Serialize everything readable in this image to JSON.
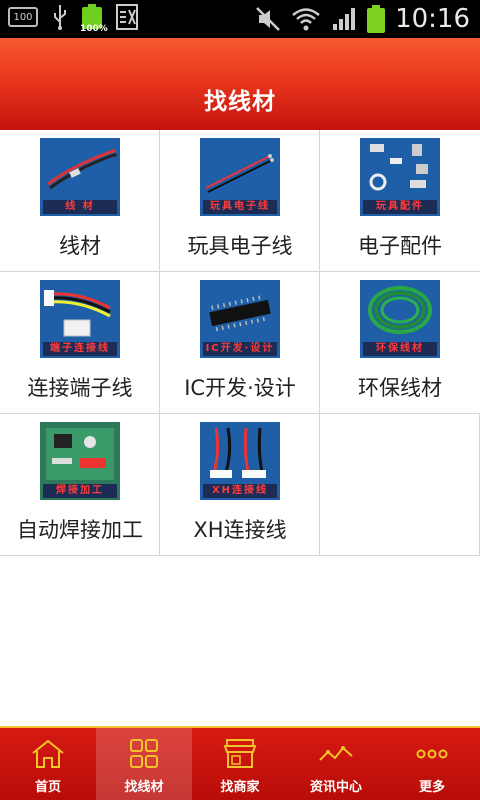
{
  "status": {
    "time": "10:16",
    "battery_small_pct": "100%",
    "box_icon_text": "100"
  },
  "header": {
    "title": "找线材"
  },
  "grid": [
    {
      "label": "线材",
      "caption": "线 材",
      "icon": "wire-image"
    },
    {
      "label": "玩具电子线",
      "caption": "玩具电子线",
      "icon": "toy-wire-image"
    },
    {
      "label": "电子配件",
      "caption": "玩具配件",
      "icon": "parts-image"
    },
    {
      "label": "连接端子线",
      "caption": "端子连接线",
      "icon": "terminal-wire-image"
    },
    {
      "label": "IC开发·设计",
      "caption": "IC开发·设计",
      "icon": "ic-chip-image"
    },
    {
      "label": "环保线材",
      "caption": "环保线材",
      "icon": "eco-wire-image"
    },
    {
      "label": "自动焊接加工",
      "caption": "焊接加工",
      "icon": "pcb-image"
    },
    {
      "label": "XH连接线",
      "caption": "XH连接线",
      "icon": "xh-wire-image"
    }
  ],
  "nav": [
    {
      "label": "首页",
      "icon": "home-icon",
      "active": false
    },
    {
      "label": "找线材",
      "icon": "grid-icon",
      "active": true
    },
    {
      "label": "找商家",
      "icon": "store-icon",
      "active": false
    },
    {
      "label": "资讯中心",
      "icon": "news-icon",
      "active": false
    },
    {
      "label": "更多",
      "icon": "more-icon",
      "active": false
    }
  ],
  "colors": {
    "header_top": "#f65a30",
    "header_bottom": "#c4140d",
    "nav_bg": "#d61a12",
    "nav_border": "#f2c42a",
    "thumb_bg": "#1f5fa8"
  }
}
